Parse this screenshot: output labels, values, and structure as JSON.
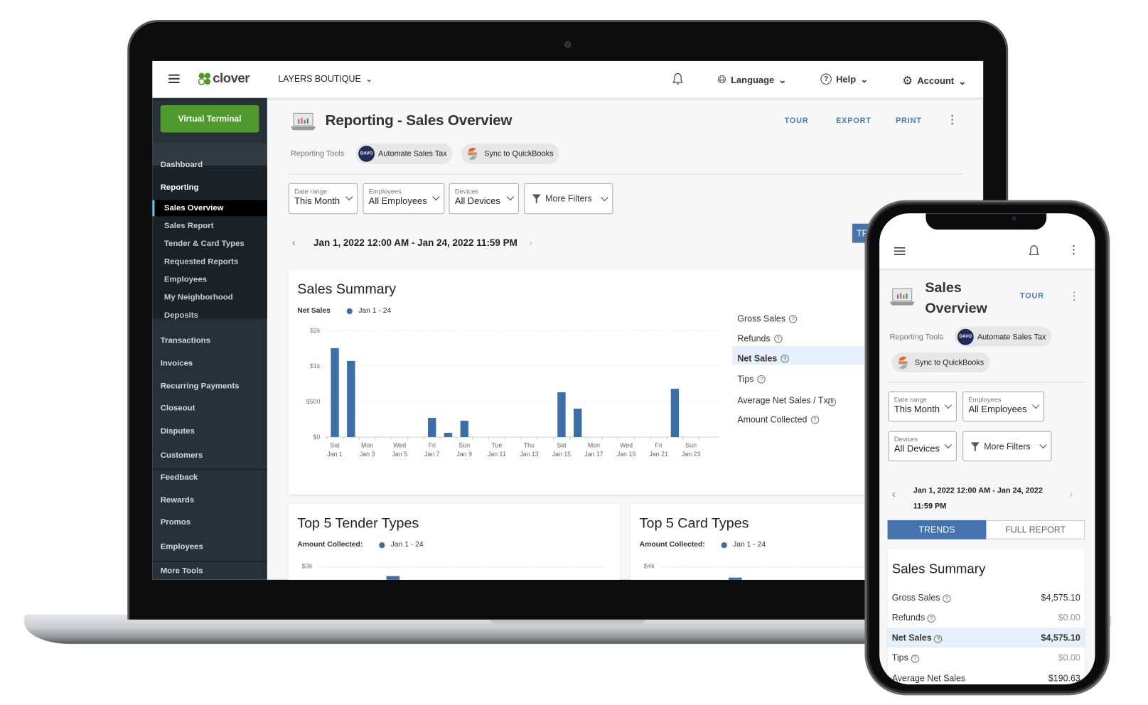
{
  "laptop": {
    "header": {
      "brand": "clover",
      "business": "LAYERS BOUTIQUE",
      "language": "Language",
      "help": "Help",
      "account": "Account"
    },
    "sidebar": {
      "virtual_terminal": "Virtual Terminal",
      "items": [
        {
          "label": "Dashboard",
          "kind": "top"
        },
        {
          "label": "Reporting",
          "kind": "section"
        },
        {
          "label": "Sales Overview",
          "kind": "sub",
          "selected": true
        },
        {
          "label": "Sales Report",
          "kind": "sub"
        },
        {
          "label": "Tender & Card Types",
          "kind": "sub"
        },
        {
          "label": "Requested Reports",
          "kind": "sub"
        },
        {
          "label": "Employees",
          "kind": "sub"
        },
        {
          "label": "My Neighborhood",
          "kind": "sub"
        },
        {
          "label": "Deposits",
          "kind": "sub"
        },
        {
          "label": "Transactions",
          "kind": "top"
        },
        {
          "label": "Invoices",
          "kind": "top"
        },
        {
          "label": "Recurring Payments",
          "kind": "top"
        },
        {
          "label": "Closeout",
          "kind": "top"
        },
        {
          "label": "Disputes",
          "kind": "top"
        },
        {
          "label": "Customers",
          "kind": "top"
        },
        {
          "label": "Feedback",
          "kind": "top"
        },
        {
          "label": "Rewards",
          "kind": "top"
        },
        {
          "label": "Promos",
          "kind": "top"
        },
        {
          "label": "Employees",
          "kind": "top"
        },
        {
          "label": "More Tools",
          "kind": "top"
        }
      ]
    },
    "page": {
      "title": "Reporting - Sales Overview",
      "tour": "TOUR",
      "export": "EXPORT",
      "print": "PRINT",
      "reporting_tools_label": "Reporting Tools",
      "tools": [
        {
          "label": "Automate Sales Tax",
          "logo": "DAVO"
        },
        {
          "label": "Sync to QuickBooks"
        }
      ],
      "filters": [
        {
          "label": "Date range",
          "value": "This Month"
        },
        {
          "label": "Employees",
          "value": "All Employees"
        },
        {
          "label": "Devices",
          "value": "All Devices"
        }
      ],
      "more_filters": "More Filters",
      "date_range": "Jan 1, 2022 12:00 AM - Jan 24, 2022 11:59 PM",
      "trends_tab": "TRENDS"
    },
    "sales_summary": {
      "title": "Sales Summary",
      "legend_label": "Net Sales",
      "legend_series": "Jan 1 - 24",
      "metrics": [
        "Gross Sales",
        "Refunds",
        "Net Sales",
        "Tips",
        "Average Net Sales / Txn",
        "Amount Collected"
      ],
      "selected_metric": "Net Sales"
    },
    "tender_card": {
      "title": "Top 5 Tender Types",
      "legend_label": "Amount Collected:",
      "legend_series": "Jan 1 - 24",
      "y_top_tick": "$3k"
    },
    "card_types_card": {
      "title": "Top 5 Card Types",
      "legend_label": "Amount Collected:",
      "legend_series": "Jan 1 - 24",
      "y_top_tick": "$4k"
    }
  },
  "chart_data": {
    "type": "bar",
    "legend": "Jan 1 - 24",
    "ylabel": "Net Sales",
    "categories": [
      "Jan 1",
      "Jan 2",
      "Jan 3",
      "Jan 4",
      "Jan 5",
      "Jan 6",
      "Jan 7",
      "Jan 8",
      "Jan 9",
      "Jan 10",
      "Jan 11",
      "Jan 12",
      "Jan 13",
      "Jan 14",
      "Jan 15",
      "Jan 16",
      "Jan 17",
      "Jan 18",
      "Jan 19",
      "Jan 20",
      "Jan 21",
      "Jan 22",
      "Jan 23",
      "Jan 24"
    ],
    "values": [
      1250,
      1070,
      0,
      0,
      0,
      0,
      270,
      60,
      230,
      0,
      0,
      0,
      0,
      0,
      630,
      400,
      0,
      0,
      0,
      0,
      0,
      680,
      0,
      0
    ],
    "x_tick_labels": [
      [
        "Sat",
        "Jan 1"
      ],
      [
        "Mon",
        "Jan 3"
      ],
      [
        "Wed",
        "Jan 5"
      ],
      [
        "Fri",
        "Jan 7"
      ],
      [
        "Sun",
        "Jan 9"
      ],
      [
        "Tue",
        "Jan 11"
      ],
      [
        "Thu",
        "Jan 13"
      ],
      [
        "Sat",
        "Jan 15"
      ],
      [
        "Mon",
        "Jan 17"
      ],
      [
        "Wed",
        "Jan 19"
      ],
      [
        "Fri",
        "Jan 21"
      ],
      [
        "Sun",
        "Jan 23"
      ]
    ],
    "y_ticks": [
      {
        "value": 0,
        "label": "$0"
      },
      {
        "value": 500,
        "label": "$500"
      },
      {
        "value": 1000,
        "label": "$1k"
      },
      {
        "value": 1500,
        "label": "$2k"
      }
    ],
    "ylim": [
      0,
      1500
    ],
    "grid": true,
    "color": "#3d6ea8"
  },
  "phone": {
    "title_line1": "Sales",
    "title_line2": "Overview",
    "tour": "TOUR",
    "reporting_tools_label": "Reporting Tools",
    "tools": [
      "Automate Sales Tax",
      "Sync to QuickBooks"
    ],
    "filters": [
      {
        "label": "Date range",
        "value": "This Month"
      },
      {
        "label": "Employees",
        "value": "All Employees"
      },
      {
        "label": "Devices",
        "value": "All Devices"
      }
    ],
    "more_filters": "More Filters",
    "date_line1": "Jan 1, 2022 12:00 AM - Jan 24, 2022",
    "date_line2": "11:59 PM",
    "tabs": [
      "TRENDS",
      "FULL REPORT"
    ],
    "summary_title": "Sales Summary",
    "rows": [
      {
        "label": "Gross Sales",
        "value": "$4,575.10"
      },
      {
        "label": "Refunds",
        "value": "$0.00"
      },
      {
        "label": "Net Sales",
        "value": "$4,575.10"
      },
      {
        "label": "Tips",
        "value": "$0.00"
      },
      {
        "label": "Average Net Sales",
        "value": "$190.63"
      }
    ]
  },
  "colors": {
    "accent": "#4a7ab5",
    "brand_green": "#4f9a2c",
    "sidebar": "#27313a",
    "bar": "#3d6ea8"
  }
}
